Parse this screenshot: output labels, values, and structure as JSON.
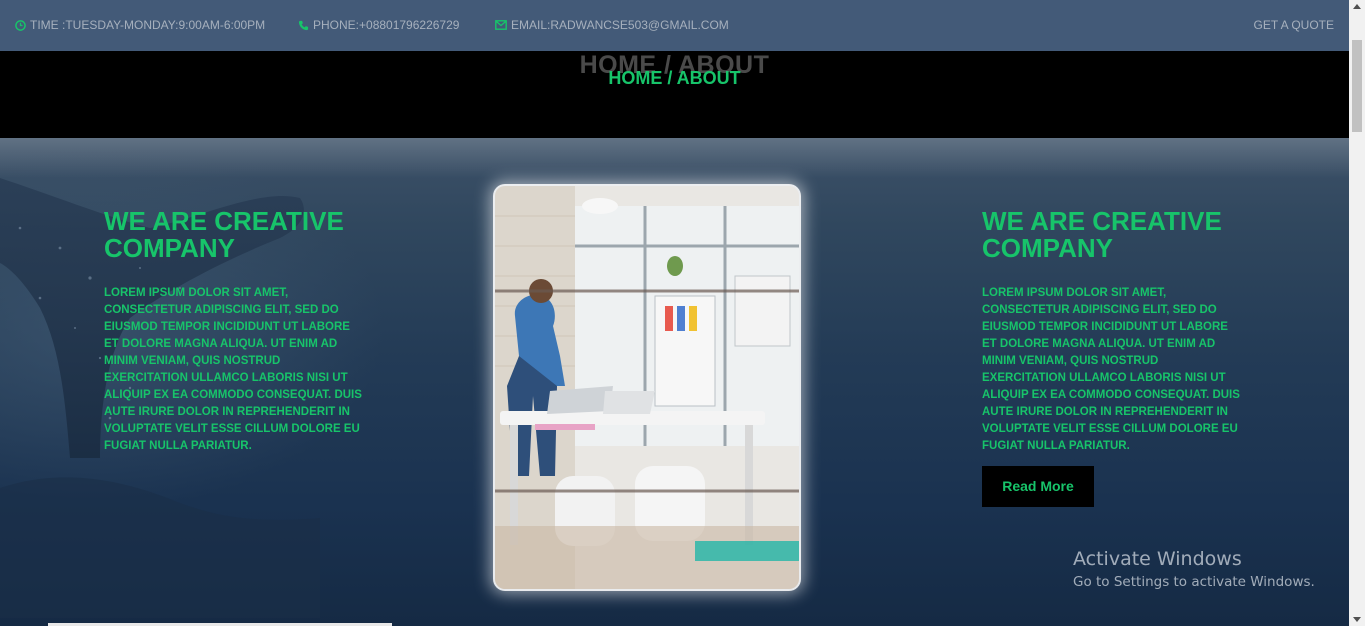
{
  "topbar": {
    "time": "TIME :TUESDAY-MONDAY:9:00AM-6:00PM",
    "phone": "PHONE:+08801796226729",
    "email": "EMAIL:RADWANCSE503@GMAIL.COM",
    "quote": "GET A QUOTE"
  },
  "banner": {
    "shadow_title": "HOME / ABOUT",
    "breadcrumb": "HOME / ABOUT"
  },
  "left": {
    "heading": "WE ARE CREATIVE COMPANY",
    "body": "LOREM IPSUM DOLOR SIT AMET, CONSECTETUR ADIPISCING ELIT, SED DO EIUSMOD TEMPOR INCIDIDUNT UT LABORE ET DOLORE MAGNA ALIQUA. UT ENIM AD MINIM VENIAM, QUIS NOSTRUD EXERCITATION ULLAMCO LABORIS NISI UT ALIQUIP EX EA COMMODO CONSEQUAT. DUIS AUTE IRURE DOLOR IN REPREHENDERIT IN VOLUPTATE VELIT ESSE CILLUM DOLORE EU FUGIAT NULLA PARIATUR."
  },
  "right": {
    "heading": "WE ARE CREATIVE COMPANY",
    "body": "LOREM IPSUM DOLOR SIT AMET, CONSECTETUR ADIPISCING ELIT, SED DO EIUSMOD TEMPOR INCIDIDUNT UT LABORE ET DOLORE MAGNA ALIQUA. UT ENIM AD MINIM VENIAM, QUIS NOSTRUD EXERCITATION ULLAMCO LABORIS NISI UT ALIQUIP EX EA COMMODO CONSEQUAT. DUIS AUTE IRURE DOLOR IN REPREHENDERIT IN VOLUPTATE VELIT ESSE CILLUM DOLORE EU FUGIAT NULLA PARIATUR.",
    "button": "Read More"
  },
  "watermark": {
    "title": "Activate Windows",
    "subtitle": "Go to Settings to activate Windows."
  },
  "colors": {
    "accent": "#17c46a",
    "topbar": "#435a78",
    "banner": "#000000"
  },
  "icons": {
    "time": "clock-icon",
    "phone": "phone-icon",
    "email": "envelope-icon"
  }
}
